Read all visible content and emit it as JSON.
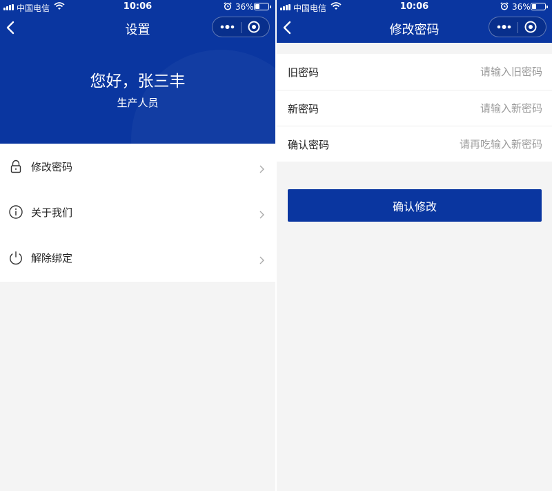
{
  "status_bar": {
    "carrier": "中国电信",
    "time": "10:06",
    "battery_percent": "36%",
    "battery_level": 0.36
  },
  "settings_screen": {
    "title": "设置",
    "greeting": "您好，张三丰",
    "role": "生产人员",
    "menu": [
      {
        "label": "修改密码",
        "icon": "lock-icon"
      },
      {
        "label": "关于我们",
        "icon": "info-icon"
      },
      {
        "label": "解除绑定",
        "icon": "power-icon"
      }
    ]
  },
  "change_password_screen": {
    "title": "修改密码",
    "fields": [
      {
        "label": "旧密码",
        "placeholder": "请输入旧密码",
        "value": ""
      },
      {
        "label": "新密码",
        "placeholder": "请输入新密码",
        "value": ""
      },
      {
        "label": "确认密码",
        "placeholder": "请再吃输入新密码",
        "value": ""
      }
    ],
    "submit_label": "确认修改"
  },
  "colors": {
    "brand_blue": "#0a36a0",
    "background": "#f4f4f4",
    "placeholder": "#9a9a9a"
  }
}
